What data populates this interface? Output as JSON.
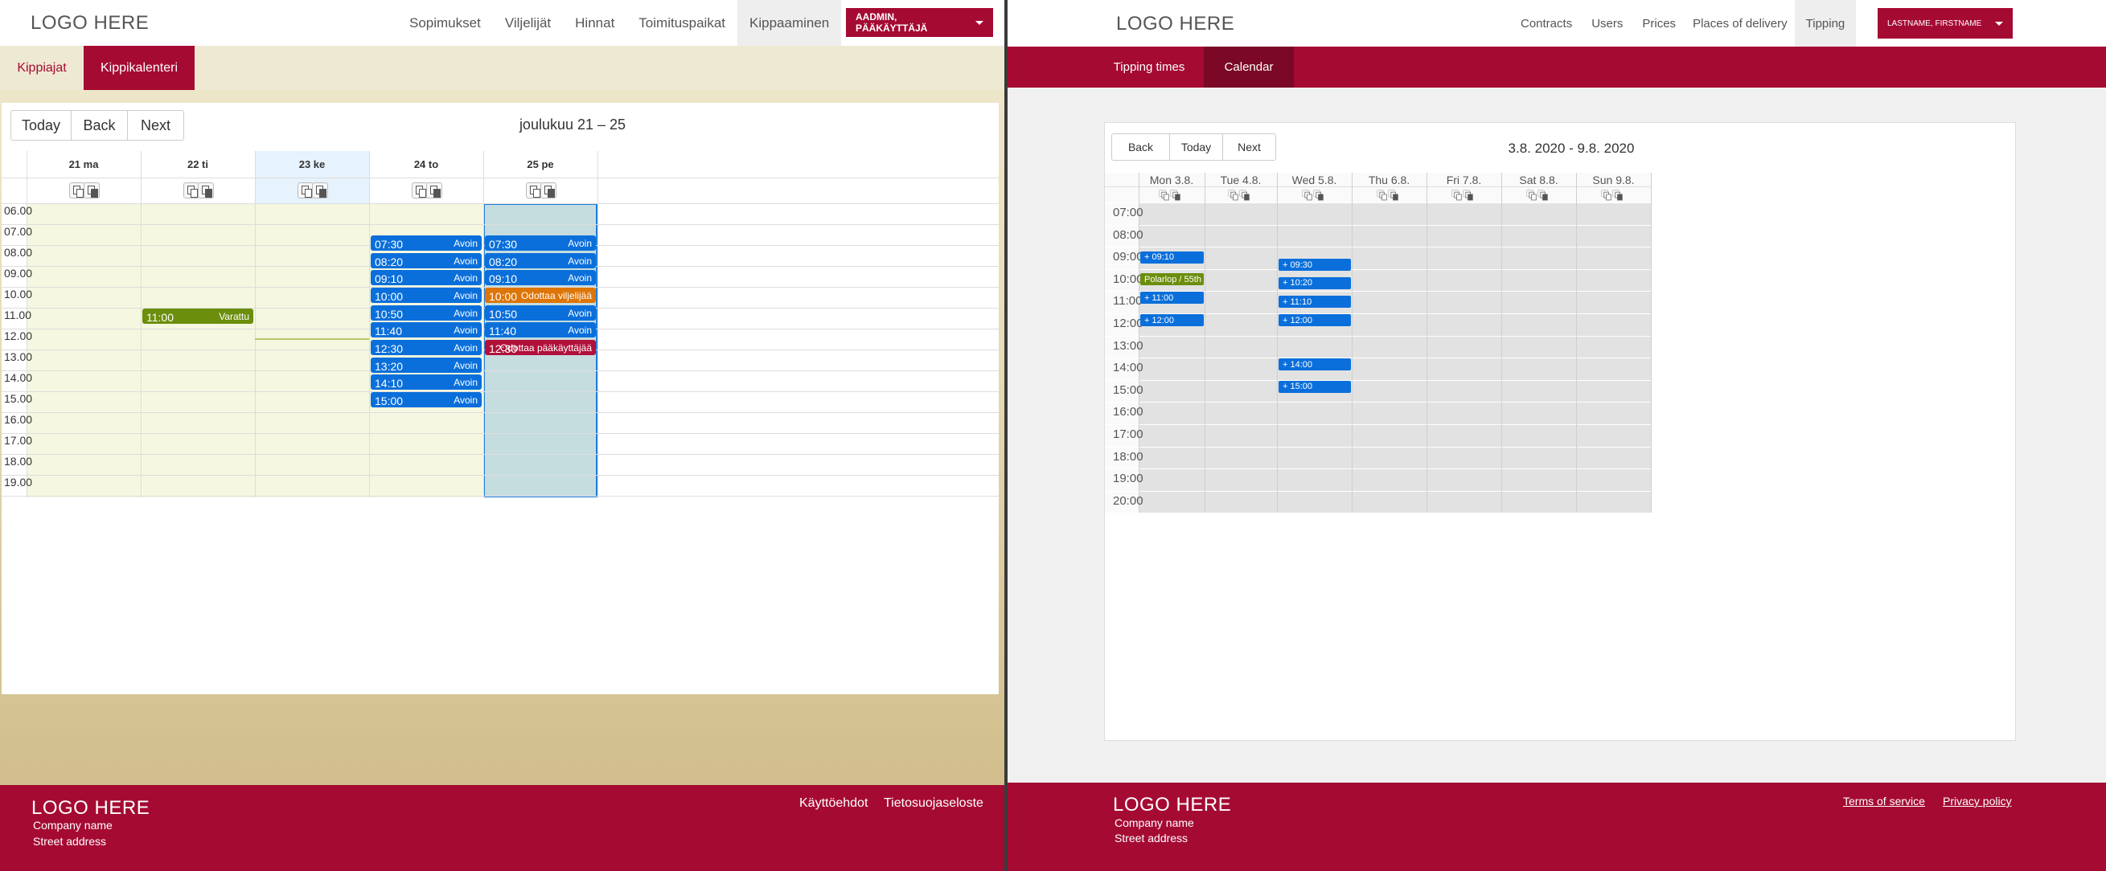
{
  "left": {
    "logo": "LOGO HERE",
    "nav": [
      "Sopimukset",
      "Viljelijät",
      "Hinnat",
      "Toimituspaikat",
      "Kippaaminen"
    ],
    "user_button": "AADMIN, PÄÄKÄYTTÄJÄ",
    "tabs": [
      "Kippiajat",
      "Kippikalenteri"
    ],
    "toolbar": {
      "today": "Today",
      "back": "Back",
      "next": "Next"
    },
    "range_title": "joulukuu 21 – 25",
    "days": [
      "21 ma",
      "22 ti",
      "23 ke",
      "24 to",
      "25 pe"
    ],
    "times": [
      "06.00",
      "07.00",
      "08.00",
      "09.00",
      "10.00",
      "11.00",
      "12.00",
      "13.00",
      "14.00",
      "15.00",
      "16.00",
      "17.00",
      "18.00",
      "19.00"
    ],
    "events": [
      {
        "day": 1,
        "time": "11:00",
        "status": "Varattu",
        "start": 11.0,
        "color": "#6b8e0c"
      },
      {
        "day": 3,
        "time": "07:30",
        "status": "Avoin",
        "start": 7.5,
        "color": "#0a6fdb"
      },
      {
        "day": 3,
        "time": "08:20",
        "status": "Avoin",
        "start": 8.333,
        "color": "#0a6fdb"
      },
      {
        "day": 3,
        "time": "09:10",
        "status": "Avoin",
        "start": 9.167,
        "color": "#0a6fdb"
      },
      {
        "day": 3,
        "time": "10:00",
        "status": "Avoin",
        "start": 10.0,
        "color": "#0a6fdb"
      },
      {
        "day": 3,
        "time": "10:50",
        "status": "Avoin",
        "start": 10.833,
        "color": "#0a6fdb"
      },
      {
        "day": 3,
        "time": "11:40",
        "status": "Avoin",
        "start": 11.667,
        "color": "#0a6fdb"
      },
      {
        "day": 3,
        "time": "12:30",
        "status": "Avoin",
        "start": 12.5,
        "color": "#0a6fdb"
      },
      {
        "day": 3,
        "time": "13:20",
        "status": "Avoin",
        "start": 13.333,
        "color": "#0a6fdb"
      },
      {
        "day": 3,
        "time": "14:10",
        "status": "Avoin",
        "start": 14.167,
        "color": "#0a6fdb"
      },
      {
        "day": 3,
        "time": "15:00",
        "status": "Avoin",
        "start": 15.0,
        "color": "#0a6fdb"
      },
      {
        "day": 4,
        "time": "07:30",
        "status": "Avoin",
        "start": 7.5,
        "color": "#0a6fdb"
      },
      {
        "day": 4,
        "time": "08:20",
        "status": "Avoin",
        "start": 8.333,
        "color": "#0a6fdb"
      },
      {
        "day": 4,
        "time": "09:10",
        "status": "Avoin",
        "start": 9.167,
        "color": "#0a6fdb"
      },
      {
        "day": 4,
        "time": "10:00",
        "status": "Odottaa viljelijää",
        "start": 10.0,
        "color": "#dd7507"
      },
      {
        "day": 4,
        "time": "10:50",
        "status": "Avoin",
        "start": 10.833,
        "color": "#0a6fdb"
      },
      {
        "day": 4,
        "time": "11:40",
        "status": "Avoin",
        "start": 11.667,
        "color": "#0a6fdb"
      },
      {
        "day": 4,
        "time": "12:30",
        "status": "Odottaa pääkäyttäjää",
        "start": 12.5,
        "color": "#b0103a"
      }
    ],
    "footer": {
      "logo": "LOGO HERE",
      "company": "Company name",
      "address": "Street address",
      "links": [
        "Käyttöehdot",
        "Tietosuojaseloste"
      ]
    }
  },
  "right": {
    "logo": "LOGO HERE",
    "nav": [
      "Contracts",
      "Users",
      "Prices",
      "Places of delivery",
      "Tipping"
    ],
    "user_button": "LASTNAME, FIRSTNAME",
    "tabs": [
      "Tipping times",
      "Calendar"
    ],
    "toolbar": {
      "back": "Back",
      "today": "Today",
      "next": "Next"
    },
    "range_title": "3.8. 2020 - 9.8. 2020",
    "days": [
      "Mon 3.8.",
      "Tue 4.8.",
      "Wed 5.8.",
      "Thu 6.8.",
      "Fri 7.8.",
      "Sat 8.8.",
      "Sun 9.8."
    ],
    "times": [
      "07:00",
      "08:00",
      "09:00",
      "10:00",
      "11:00",
      "12:00",
      "13:00",
      "14:00",
      "15:00",
      "16:00",
      "17:00",
      "18:00",
      "19:00",
      "20:00"
    ],
    "events": [
      {
        "day": 0,
        "label": "+ 09:10",
        "start": 9.167,
        "color": "#0a6fdb"
      },
      {
        "day": 0,
        "label": "Polarlop / 55th",
        "start": 10.167,
        "color": "#6b8e0c"
      },
      {
        "day": 0,
        "label": "+ 11:00",
        "start": 11.0,
        "color": "#0a6fdb"
      },
      {
        "day": 0,
        "label": "+ 12:00",
        "start": 12.0,
        "color": "#0a6fdb"
      },
      {
        "day": 2,
        "label": "+ 09:30",
        "start": 9.5,
        "color": "#0a6fdb"
      },
      {
        "day": 2,
        "label": "+ 10:20",
        "start": 10.333,
        "color": "#0a6fdb"
      },
      {
        "day": 2,
        "label": "+ 11:10",
        "start": 11.167,
        "color": "#0a6fdb"
      },
      {
        "day": 2,
        "label": "+ 12:00",
        "start": 12.0,
        "color": "#0a6fdb"
      },
      {
        "day": 2,
        "label": "+ 14:00",
        "start": 14.0,
        "color": "#0a6fdb"
      },
      {
        "day": 2,
        "label": "+ 15:00",
        "start": 15.0,
        "color": "#0a6fdb"
      }
    ],
    "footer": {
      "logo": "LOGO HERE",
      "company": "Company name",
      "address": "Street address",
      "links": [
        "Terms of service",
        "Privacy policy"
      ]
    }
  }
}
